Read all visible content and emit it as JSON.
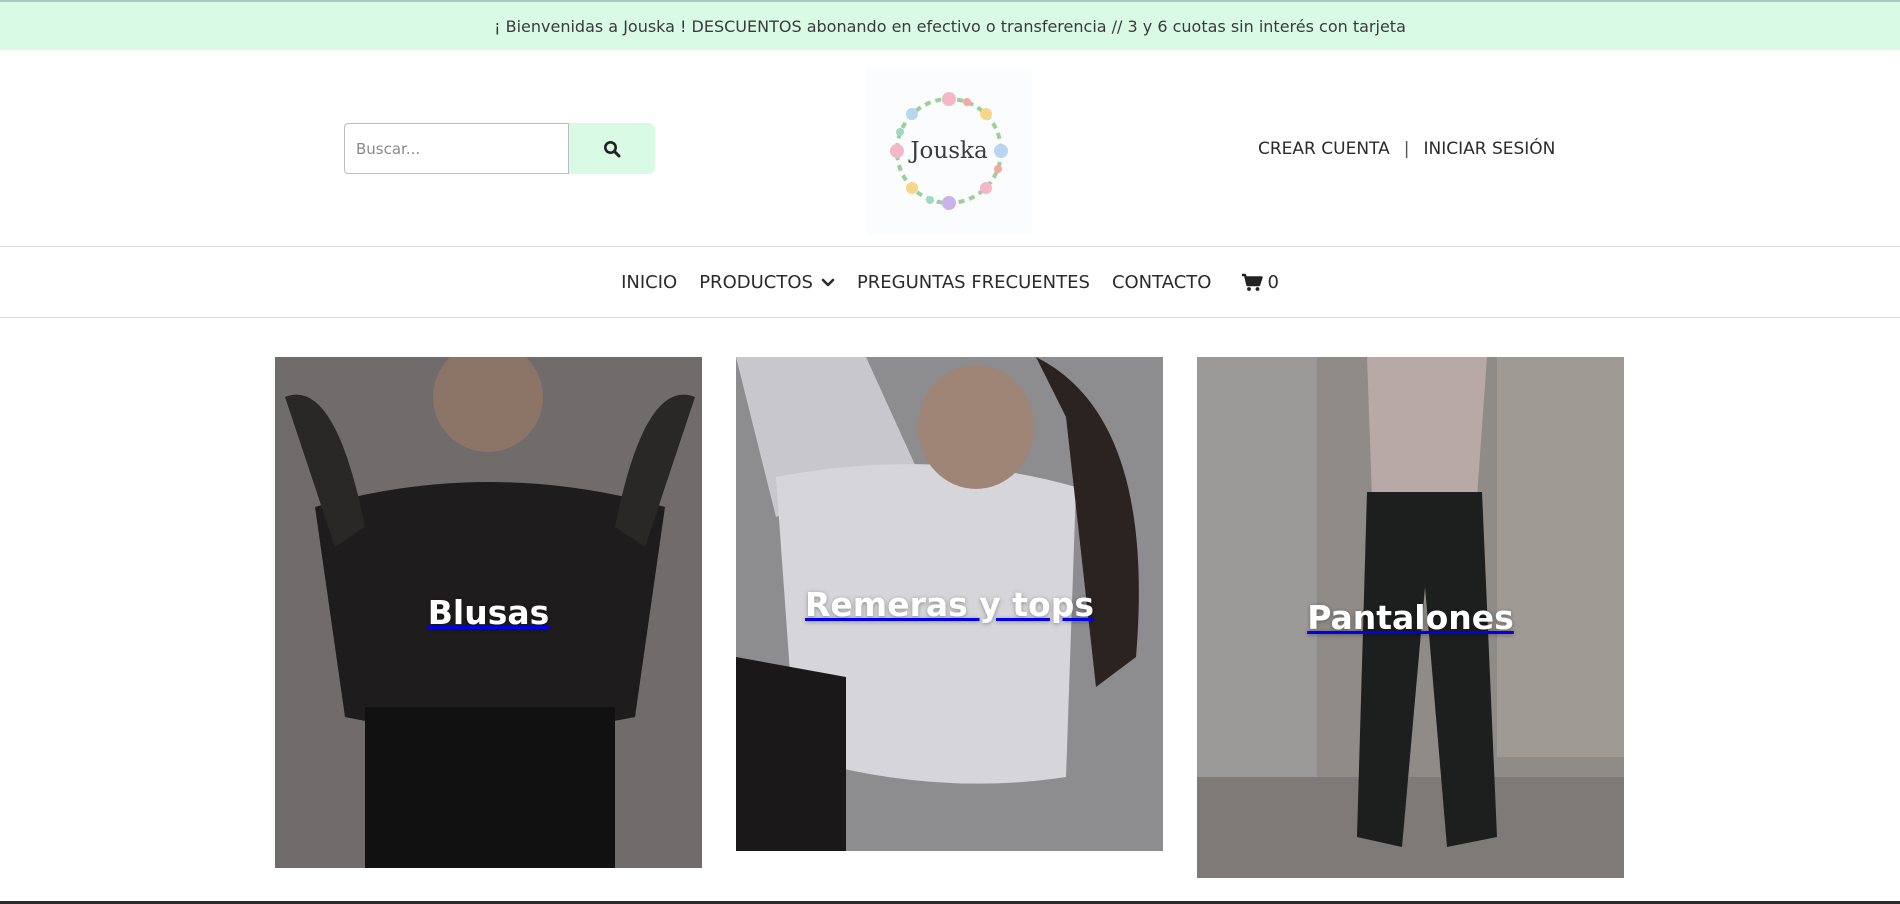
{
  "announcement": "¡ Bienvenidas a Jouska ! DESCUENTOS abonando en efectivo o transferencia // 3 y 6 cuotas sin interés con tarjeta",
  "search": {
    "placeholder": "Buscar..."
  },
  "logo": {
    "text": "Jouska"
  },
  "account": {
    "create_label": "CREAR CUENTA",
    "separator": "|",
    "login_label": "INICIAR SESIÓN"
  },
  "nav": {
    "items": [
      {
        "label": "INICIO"
      },
      {
        "label": "PRODUCTOS"
      },
      {
        "label": "PREGUNTAS FRECUENTES"
      },
      {
        "label": "CONTACTO"
      }
    ],
    "cart_count": "0"
  },
  "categories": [
    {
      "label": "Blusas"
    },
    {
      "label": "Remeras y tops"
    },
    {
      "label": "Pantalones"
    }
  ],
  "colors": {
    "announcement_bg": "#d9fbe5",
    "search_button_bg": "#d9fbe5",
    "text": "#2b2b2b"
  }
}
